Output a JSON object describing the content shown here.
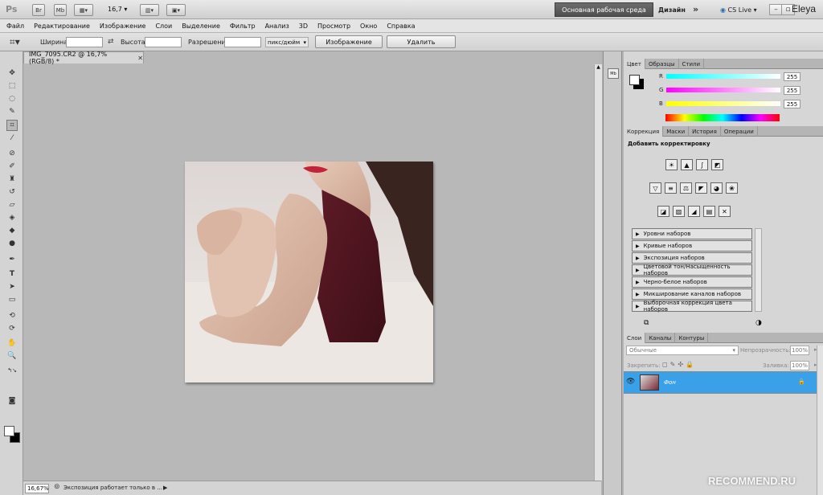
{
  "appbar": {
    "app_badge": "Ps",
    "bridge": "Br",
    "minibridge": "Mb",
    "zoom": "16,7",
    "workspace_active": "Основная рабочая среда",
    "workspace_other": "Дизайн",
    "cs_live": "CS Live",
    "user": "Eleya"
  },
  "menu": [
    "Файл",
    "Редактирование",
    "Изображение",
    "Слои",
    "Выделение",
    "Фильтр",
    "Анализ",
    "3D",
    "Просмотр",
    "Окно",
    "Справка"
  ],
  "options": {
    "width_label": "Ширина:",
    "height_label": "Высота:",
    "resolution_label": "Разрешение:",
    "unit": "пикс/дюйм",
    "front_image_btn": "Изображение",
    "clear_btn": "Удалить"
  },
  "document": {
    "tab_title": "IMG_7095.CR2 @ 16,7% (RGB/8) *",
    "zoom": "16,67%",
    "status": "Экспозиция работает только в ..."
  },
  "color_panel": {
    "tabs": [
      "Цвет",
      "Образцы",
      "Стили"
    ],
    "channels": [
      {
        "label": "R",
        "value": "255"
      },
      {
        "label": "G",
        "value": "255"
      },
      {
        "label": "B",
        "value": "255"
      }
    ]
  },
  "adjustments_panel": {
    "tabs": [
      "Коррекция",
      "Маски",
      "История",
      "Операции"
    ],
    "heading": "Добавить корректировку",
    "presets": [
      "Уровни наборов",
      "Кривые наборов",
      "Экспозиция наборов",
      "Цветовой тон/Насыщенность наборов",
      "Черно-белое наборов",
      "Микширование каналов наборов",
      "Выборочная коррекция цвета наборов"
    ]
  },
  "layers_panel": {
    "tabs": [
      "Слои",
      "Каналы",
      "Контуры"
    ],
    "blend_mode": "Обычные",
    "opacity_label": "Непрозрачность:",
    "opacity": "100%",
    "lock_label": "Закрепить:",
    "fill_label": "Заливка:",
    "fill": "100%",
    "layer_name": "Фон"
  },
  "watermark": "RECOMMEND.RU",
  "colors": {
    "layer_selected": "#3aa0e8",
    "workspace_active": "#5a5a5a"
  }
}
